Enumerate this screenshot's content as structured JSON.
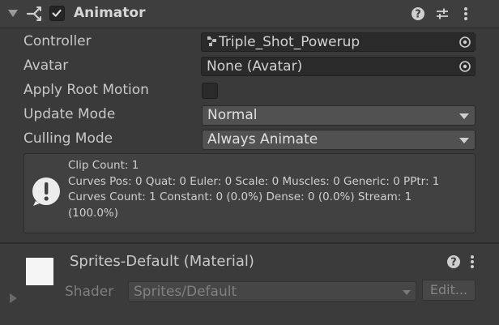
{
  "animator": {
    "title": "Animator",
    "enabled": true,
    "header_icons": [
      "help-icon",
      "preset-icon",
      "menu-icon"
    ],
    "controller": {
      "label": "Controller",
      "value": "Triple_Shot_Powerup"
    },
    "avatar": {
      "label": "Avatar",
      "value": "None (Avatar)"
    },
    "apply_root_motion": {
      "label": "Apply Root Motion",
      "checked": false
    },
    "update_mode": {
      "label": "Update Mode",
      "value": "Normal"
    },
    "culling_mode": {
      "label": "Culling Mode",
      "value": "Always Animate"
    },
    "info": {
      "line1": "Clip Count: 1",
      "line2": "Curves Pos: 0 Quat: 0 Euler: 0 Scale: 0 Muscles: 0 Generic: 0 PPtr: 1",
      "line3": "Curves Count: 1 Constant: 0 (0.0%) Dense: 0 (0.0%) Stream: 1",
      "line4": "(100.0%)"
    }
  },
  "material": {
    "title": "Sprites-Default (Material)",
    "shader_label": "Shader",
    "shader_value": "Sprites/Default",
    "edit_label": "Edit...",
    "header_icons": [
      "help-icon",
      "menu-icon"
    ]
  },
  "colors": {
    "panel_bg": "#3a3a3a",
    "field_bg": "#2a2a2a",
    "dropdown_bg": "#515151",
    "text": "#c8c8c8",
    "disabled_text": "#808080"
  }
}
